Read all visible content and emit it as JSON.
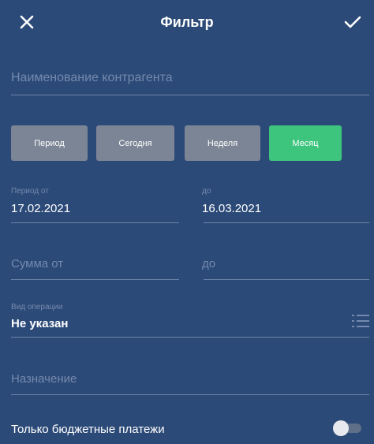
{
  "header": {
    "title": "Фильтр",
    "close_icon": "close-icon",
    "confirm_icon": "check-icon"
  },
  "fields": {
    "counterparty": {
      "placeholder": "Наименование контрагента"
    },
    "period_chips": [
      {
        "label": "Период",
        "active": false
      },
      {
        "label": "Сегодня",
        "active": false
      },
      {
        "label": "Неделя",
        "active": false
      },
      {
        "label": "Месяц",
        "active": true
      }
    ],
    "period_from": {
      "label": "Период от",
      "value": "17.02.2021"
    },
    "period_to": {
      "label": "до",
      "value": "16.03.2021"
    },
    "amount_from": {
      "placeholder": "Сумма от"
    },
    "amount_to": {
      "placeholder": "до"
    },
    "operation_type": {
      "label": "Вид операции",
      "value": "Не указан",
      "icon": "list-icon"
    },
    "purpose": {
      "placeholder": "Назначение"
    },
    "budget_only": {
      "label": "Только бюджетные платежи",
      "enabled": false
    }
  },
  "colors": {
    "background": "#2c4a78",
    "chip_inactive": "#7c8595",
    "chip_active": "#3dc57d",
    "placeholder": "#7489ad",
    "underline": "#6b83a8"
  }
}
